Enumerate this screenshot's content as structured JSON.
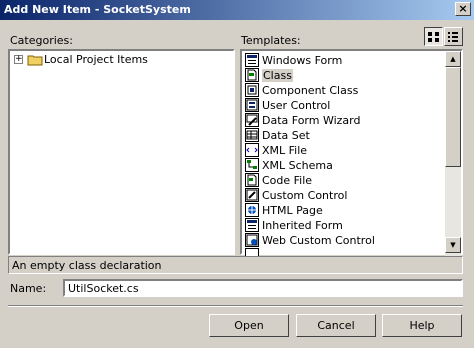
{
  "window": {
    "title": "Add New Item - SocketSystem",
    "close_glyph": "×"
  },
  "labels": {
    "categories": "Categories:",
    "templates": "Templates:",
    "name": "Name:"
  },
  "categories": [
    {
      "label": "Local Project Items",
      "expander": "+"
    }
  ],
  "templates": [
    {
      "label": "Windows Form",
      "icon": "windows-form-icon"
    },
    {
      "label": "Class",
      "icon": "class-icon",
      "selected": true
    },
    {
      "label": "Component Class",
      "icon": "component-class-icon"
    },
    {
      "label": "User Control",
      "icon": "user-control-icon"
    },
    {
      "label": "Data Form Wizard",
      "icon": "data-form-wizard-icon"
    },
    {
      "label": "Data Set",
      "icon": "data-set-icon"
    },
    {
      "label": "XML File",
      "icon": "xml-file-icon"
    },
    {
      "label": "XML Schema",
      "icon": "xml-schema-icon"
    },
    {
      "label": "Code File",
      "icon": "code-file-icon"
    },
    {
      "label": "Custom Control",
      "icon": "custom-control-icon"
    },
    {
      "label": "HTML Page",
      "icon": "html-page-icon"
    },
    {
      "label": "Inherited Form",
      "icon": "inherited-form-icon"
    },
    {
      "label": "Web Custom Control",
      "icon": "web-custom-control-icon"
    }
  ],
  "description": "An empty class declaration",
  "name_field": {
    "value": "UtilSocket.cs"
  },
  "buttons": {
    "open": "Open",
    "cancel": "Cancel",
    "help": "Help"
  },
  "colors": {
    "title_bar_start": "#0a246a",
    "title_bar_end": "#a6caf0",
    "dialog_bg": "#d4d0c8"
  }
}
